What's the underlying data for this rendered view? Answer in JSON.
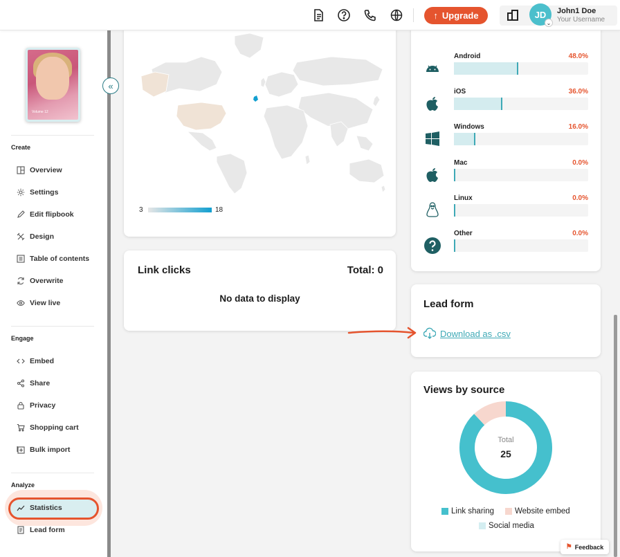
{
  "header": {
    "upgrade_label": "Upgrade",
    "user_name": "John1 Doe",
    "user_sub": "Your Username",
    "avatar_initials": "JD",
    "accent": "#e5542e"
  },
  "sidebar": {
    "cover_lines": [
      "Volume 12"
    ],
    "collapse_symbol": "«",
    "sections": {
      "create": "Create",
      "engage": "Engage",
      "analyze": "Analyze"
    },
    "items": [
      {
        "label": "Overview",
        "icon": "layout-icon"
      },
      {
        "label": "Settings",
        "icon": "gear-icon"
      },
      {
        "label": "Edit flipbook",
        "icon": "pencil-icon"
      },
      {
        "label": "Design",
        "icon": "tools-icon"
      },
      {
        "label": "Table of contents",
        "icon": "list-icon"
      },
      {
        "label": "Overwrite",
        "icon": "refresh-icon"
      },
      {
        "label": "View live",
        "icon": "eye-icon"
      },
      {
        "label": "Embed",
        "icon": "code-icon"
      },
      {
        "label": "Share",
        "icon": "share-icon"
      },
      {
        "label": "Privacy",
        "icon": "lock-icon"
      },
      {
        "label": "Shopping cart",
        "icon": "cart-icon"
      },
      {
        "label": "Bulk import",
        "icon": "import-icon"
      },
      {
        "label": "Statistics",
        "icon": "chart-line-icon"
      },
      {
        "label": "Lead form",
        "icon": "form-icon"
      }
    ]
  },
  "map": {
    "scale_min": "3",
    "scale_max": "18"
  },
  "link_clicks": {
    "title": "Link clicks",
    "total": "Total: 0",
    "empty": "No data to display"
  },
  "os": {
    "rows": [
      {
        "name": "Android",
        "pct": "48.0%",
        "value": 0.48,
        "icon": "android-icon"
      },
      {
        "name": "iOS",
        "pct": "36.0%",
        "value": 0.36,
        "icon": "apple-icon"
      },
      {
        "name": "Windows",
        "pct": "16.0%",
        "value": 0.16,
        "icon": "windows-icon"
      },
      {
        "name": "Mac",
        "pct": "0.0%",
        "value": 0,
        "icon": "apple-icon"
      },
      {
        "name": "Linux",
        "pct": "0.0%",
        "value": 0,
        "icon": "linux-icon"
      },
      {
        "name": "Other",
        "pct": "0.0%",
        "value": 0,
        "icon": "question-icon"
      }
    ]
  },
  "lead_form": {
    "title": "Lead form",
    "download": "Download as .csv"
  },
  "views_by_source": {
    "title": "Views by source",
    "total_label": "Total",
    "total_value": "25",
    "legend": [
      "Link sharing",
      "Website embed",
      "Social media"
    ]
  },
  "chart_data": {
    "type": "pie",
    "title": "Views by source",
    "categories": [
      "Link sharing",
      "Website embed",
      "Social media"
    ],
    "values": [
      22,
      3,
      0
    ],
    "colors": [
      "#45c0cd",
      "#f7d7ce",
      "#d4eef1"
    ]
  },
  "feedback_label": "Feedback"
}
